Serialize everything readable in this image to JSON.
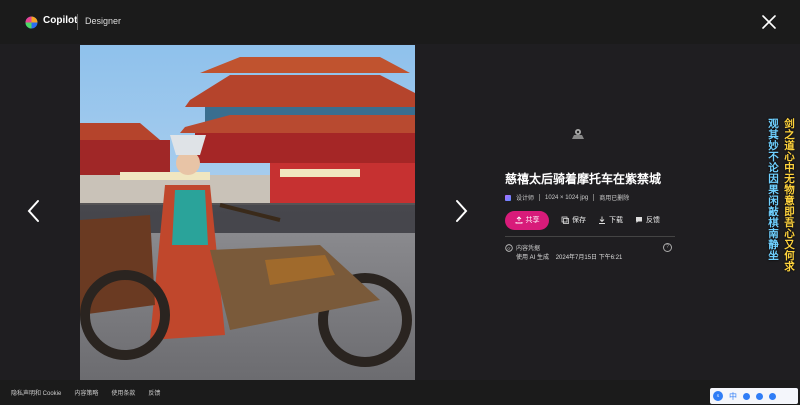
{
  "header": {
    "brand": "Copilot",
    "product": "Designer"
  },
  "image": {
    "title": "慈禧太后骑着摩托车在紫禁城",
    "meta": {
      "creator": "设计师",
      "dimensions": "1024 × 1024 jpg",
      "license": "商用已删除"
    }
  },
  "actions": {
    "share": "共享",
    "save": "保存",
    "download": "下载",
    "feedback": "反馈"
  },
  "credentials": {
    "label": "内容凭据",
    "detail": "使用 AI 生成",
    "date": "2024年7月15日 下午6:21"
  },
  "overlay": {
    "line1": "剑之道心中无物意即吾心又何求",
    "line2": "观其妙不论因果闲敲棋南静坐"
  },
  "footer": {
    "links": [
      "隐私声明和 Cookie",
      "内容策略",
      "使用条款",
      "反馈"
    ]
  },
  "ime": {
    "lang": "中"
  },
  "colors": {
    "accent": "#d81b7a",
    "background": "#1b1b1b"
  }
}
